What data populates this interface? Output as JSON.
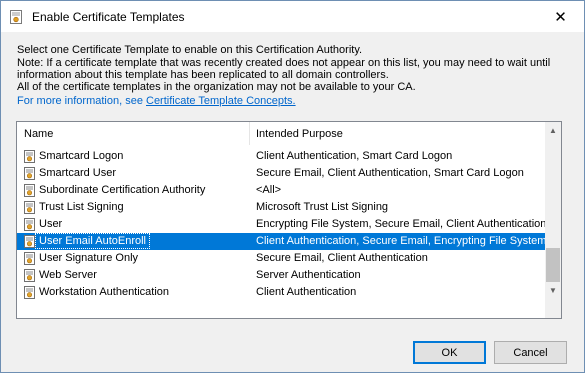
{
  "window": {
    "title": "Enable Certificate Templates",
    "close_glyph": "✕"
  },
  "description": {
    "line1": "Select one Certificate Template to enable on this Certification Authority.",
    "line2": "Note: If a certificate template that was recently created does not appear on this list, you may need to wait until",
    "line3": "information about this template has been replicated to all domain controllers.",
    "line4": "All of the certificate templates in the organization may not be available to your CA.",
    "more_prefix": "For more information, see ",
    "more_link": "Certificate Template Concepts."
  },
  "list": {
    "columns": {
      "name": "Name",
      "purpose": "Intended Purpose"
    },
    "rows": [
      {
        "name": "Smartcard Logon",
        "purpose": "Client Authentication, Smart Card Logon"
      },
      {
        "name": "Smartcard User",
        "purpose": "Secure Email, Client Authentication, Smart Card Logon"
      },
      {
        "name": "Subordinate Certification Authority",
        "purpose": "<All>"
      },
      {
        "name": "Trust List Signing",
        "purpose": "Microsoft Trust List Signing"
      },
      {
        "name": "User",
        "purpose": "Encrypting File System, Secure Email, Client Authentication"
      },
      {
        "name": "User Email AutoEnroll",
        "purpose": "Client Authentication, Secure Email, Encrypting File System",
        "selected": true
      },
      {
        "name": "User Signature Only",
        "purpose": "Secure Email, Client Authentication"
      },
      {
        "name": "Web Server",
        "purpose": "Server Authentication"
      },
      {
        "name": "Workstation Authentication",
        "purpose": "Client Authentication"
      }
    ]
  },
  "buttons": {
    "ok": "OK",
    "cancel": "Cancel"
  },
  "colors": {
    "selection": "#0078d7",
    "link": "#0066cc",
    "default_button_border": "#0078d7"
  }
}
